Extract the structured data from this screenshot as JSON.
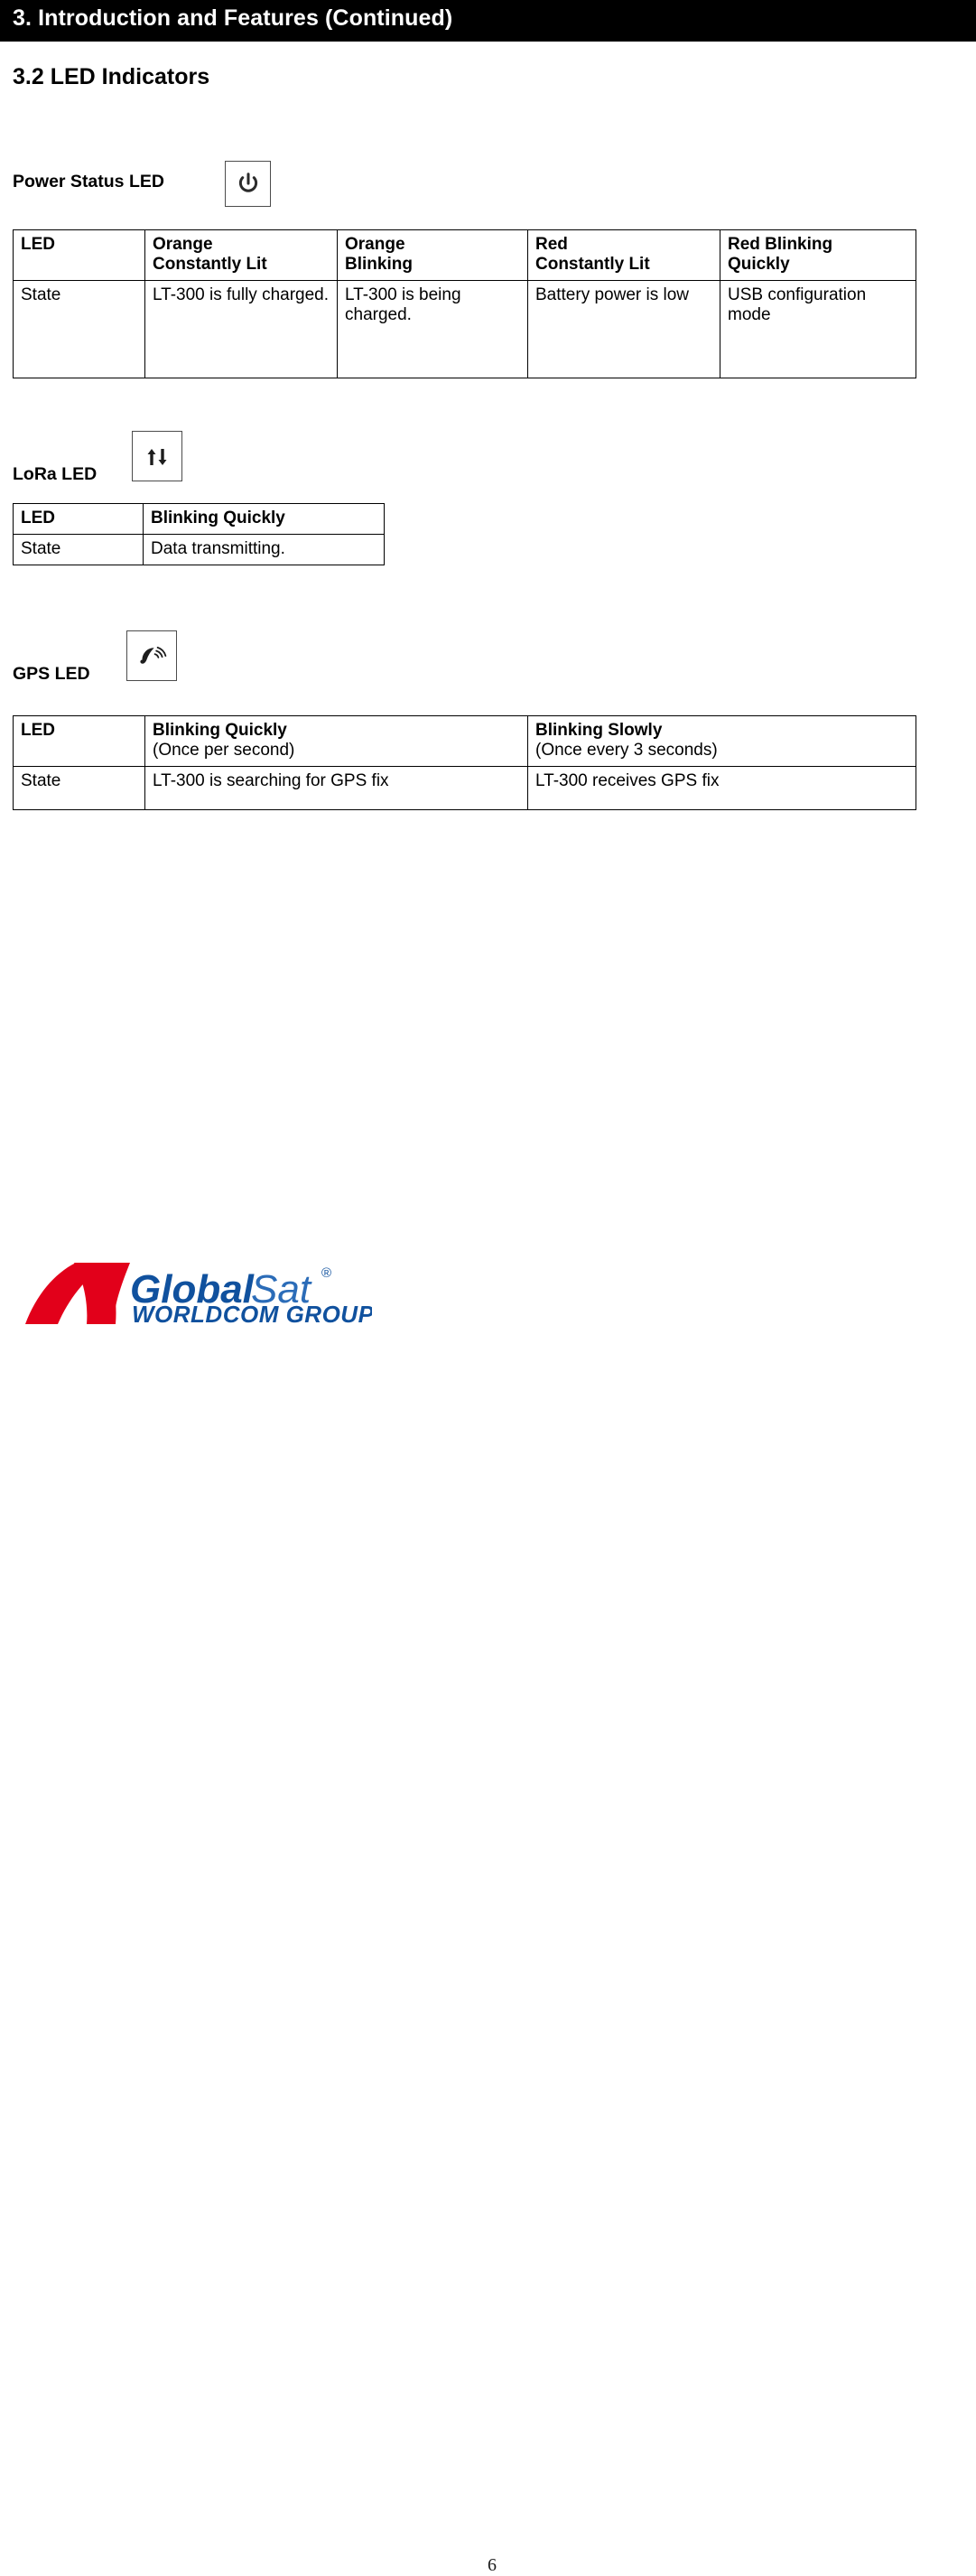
{
  "chapter": {
    "title": "3. Introduction and Features (Continued)"
  },
  "section": {
    "title": "3.2 LED Indicators"
  },
  "colors": {
    "header_bar": "#000000",
    "header_bar_text": "#ffffff",
    "table_key_fill": "#ffffb3",
    "table_header_fill": "#ffc20a",
    "table_body_fill": "#ffffff",
    "table_border": "#000000",
    "logo_red": "#e2001a",
    "logo_blue_dark": "#10519e",
    "logo_blue_light": "#2b6cb8"
  },
  "groups": [
    {
      "label": "Power Status LED",
      "icon": "power-icon",
      "table": {
        "row_labels": [
          "LED",
          "State"
        ],
        "columns": [
          {
            "header": "Orange Constantly Lit",
            "header_lines": [
              "Orange",
              "Constantly Lit"
            ],
            "state": "LT-300 is fully charged."
          },
          {
            "header": "Orange Blinking",
            "header_lines": [
              "Orange",
              "Blinking"
            ],
            "state": "LT-300 is being charged."
          },
          {
            "header": "Red Constantly Lit",
            "header_lines": [
              "Red",
              "Constantly Lit"
            ],
            "state": "Battery power is low"
          },
          {
            "header": "Red Blinking Quickly",
            "header_lines": [
              "Red Blinking",
              "Quickly"
            ],
            "state": "USB configuration mode"
          }
        ]
      }
    },
    {
      "label": "LoRa LED",
      "icon": "transfer-arrows-icon",
      "table": {
        "row_labels": [
          "LED",
          "State"
        ],
        "columns": [
          {
            "header": "Blinking Quickly",
            "header_lines": [
              "Blinking Quickly"
            ],
            "state": "Data transmitting."
          }
        ]
      }
    },
    {
      "label": "GPS LED",
      "icon": "satellite-dish-icon",
      "table": {
        "row_labels": [
          "LED",
          "State"
        ],
        "columns": [
          {
            "header": "Blinking Quickly",
            "header_note": "(Once per second)",
            "state": "LT-300 is searching for GPS fix"
          },
          {
            "header": "Blinking Slowly",
            "header_note": "(Once every 3 seconds)",
            "state": "LT-300 receives GPS fix"
          }
        ]
      }
    }
  ],
  "footer": {
    "logo": {
      "mark": "globalsat-n-mark",
      "word_primary": "Global",
      "word_secondary": "Sat",
      "registered_mark": "®",
      "tagline": "WORLDCOM GROUP"
    },
    "page_number": "6"
  }
}
